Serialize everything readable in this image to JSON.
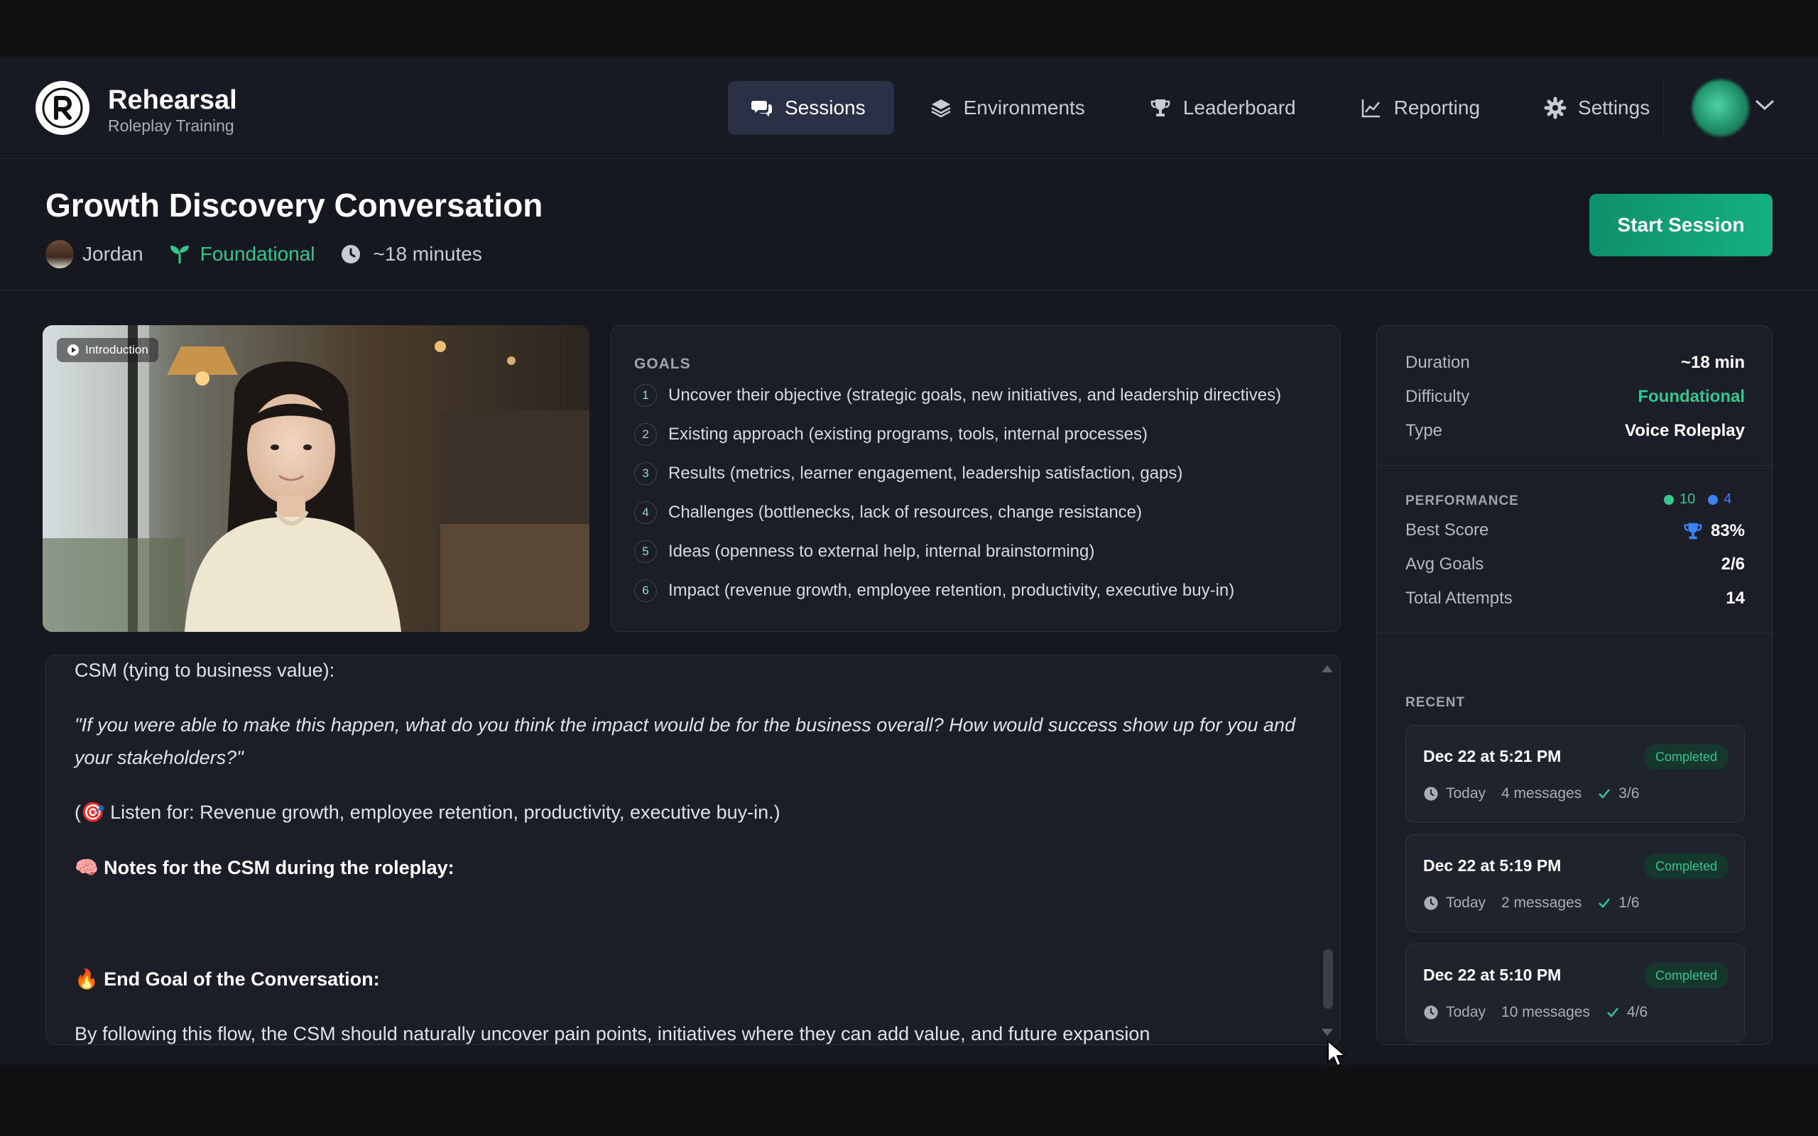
{
  "brand": {
    "title": "Rehearsal",
    "subtitle": "Roleplay Training"
  },
  "nav": [
    {
      "label": "Sessions",
      "icon": "chat-icon",
      "active": true
    },
    {
      "label": "Environments",
      "icon": "layers-icon",
      "active": false
    },
    {
      "label": "Leaderboard",
      "icon": "trophy-icon",
      "active": false
    },
    {
      "label": "Reporting",
      "icon": "chart-line-icon",
      "active": false
    },
    {
      "label": "Settings",
      "icon": "gear-icon",
      "active": false
    }
  ],
  "page": {
    "title": "Growth Discovery Conversation",
    "persona": "Jordan",
    "difficulty": "Foundational",
    "duration": "~18 minutes",
    "start_label": "Start Session"
  },
  "video": {
    "badge": "Introduction"
  },
  "goals": {
    "title": "GOALS",
    "items": [
      {
        "n": "1",
        "text": "Uncover their objective (strategic goals, new initiatives, and leadership directives)"
      },
      {
        "n": "2",
        "text": "Existing approach (existing programs, tools, internal processes)"
      },
      {
        "n": "3",
        "text": "Results (metrics, learner engagement, leadership satisfaction, gaps)"
      },
      {
        "n": "4",
        "text": "Challenges (bottlenecks, lack of resources, change resistance)"
      },
      {
        "n": "5",
        "text": "Ideas (openness to external help, internal brainstorming)"
      },
      {
        "n": "6",
        "text": "Impact (revenue growth, employee retention, productivity, executive buy-in)"
      }
    ]
  },
  "transcript": {
    "line1": "CSM (tying to business value):",
    "quote": "\"If you were able to make this happen, what do you think the impact would be for the business overall? How would success show up for you and your stakeholders?\"",
    "listen": "(🎯 Listen for: Revenue growth, employee retention, productivity, executive buy-in.)",
    "notes_heading": "🧠 Notes for the CSM during the roleplay:",
    "end_heading": "🔥 End Goal of the Conversation:",
    "last": "By following this flow, the CSM should naturally uncover pain points, initiatives where they can add value, and future expansion"
  },
  "details": {
    "duration_label": "Duration",
    "duration_value": "~18 min",
    "difficulty_label": "Difficulty",
    "difficulty_value": "Foundational",
    "type_label": "Type",
    "type_value": "Voice Roleplay"
  },
  "performance": {
    "title": "PERFORMANCE",
    "legend_green": "10",
    "legend_blue": "4",
    "best_label": "Best Score",
    "best_value": "83%",
    "avg_label": "Avg Goals",
    "avg_value": "2/6",
    "attempts_label": "Total Attempts",
    "attempts_value": "14"
  },
  "recent": {
    "title": "RECENT",
    "items": [
      {
        "when": "Dec 22 at 5:21 PM",
        "status": "Completed",
        "day": "Today",
        "messages": "4 messages",
        "goals": "3/6"
      },
      {
        "when": "Dec 22 at 5:19 PM",
        "status": "Completed",
        "day": "Today",
        "messages": "2 messages",
        "goals": "1/6"
      },
      {
        "when": "Dec 22 at 5:10 PM",
        "status": "Completed",
        "day": "Today",
        "messages": "10 messages",
        "goals": "4/6"
      }
    ]
  },
  "colors": {
    "accent_green": "#34c78f",
    "nav_active": "#2a3147",
    "legend_blue": "#3b82f6"
  }
}
